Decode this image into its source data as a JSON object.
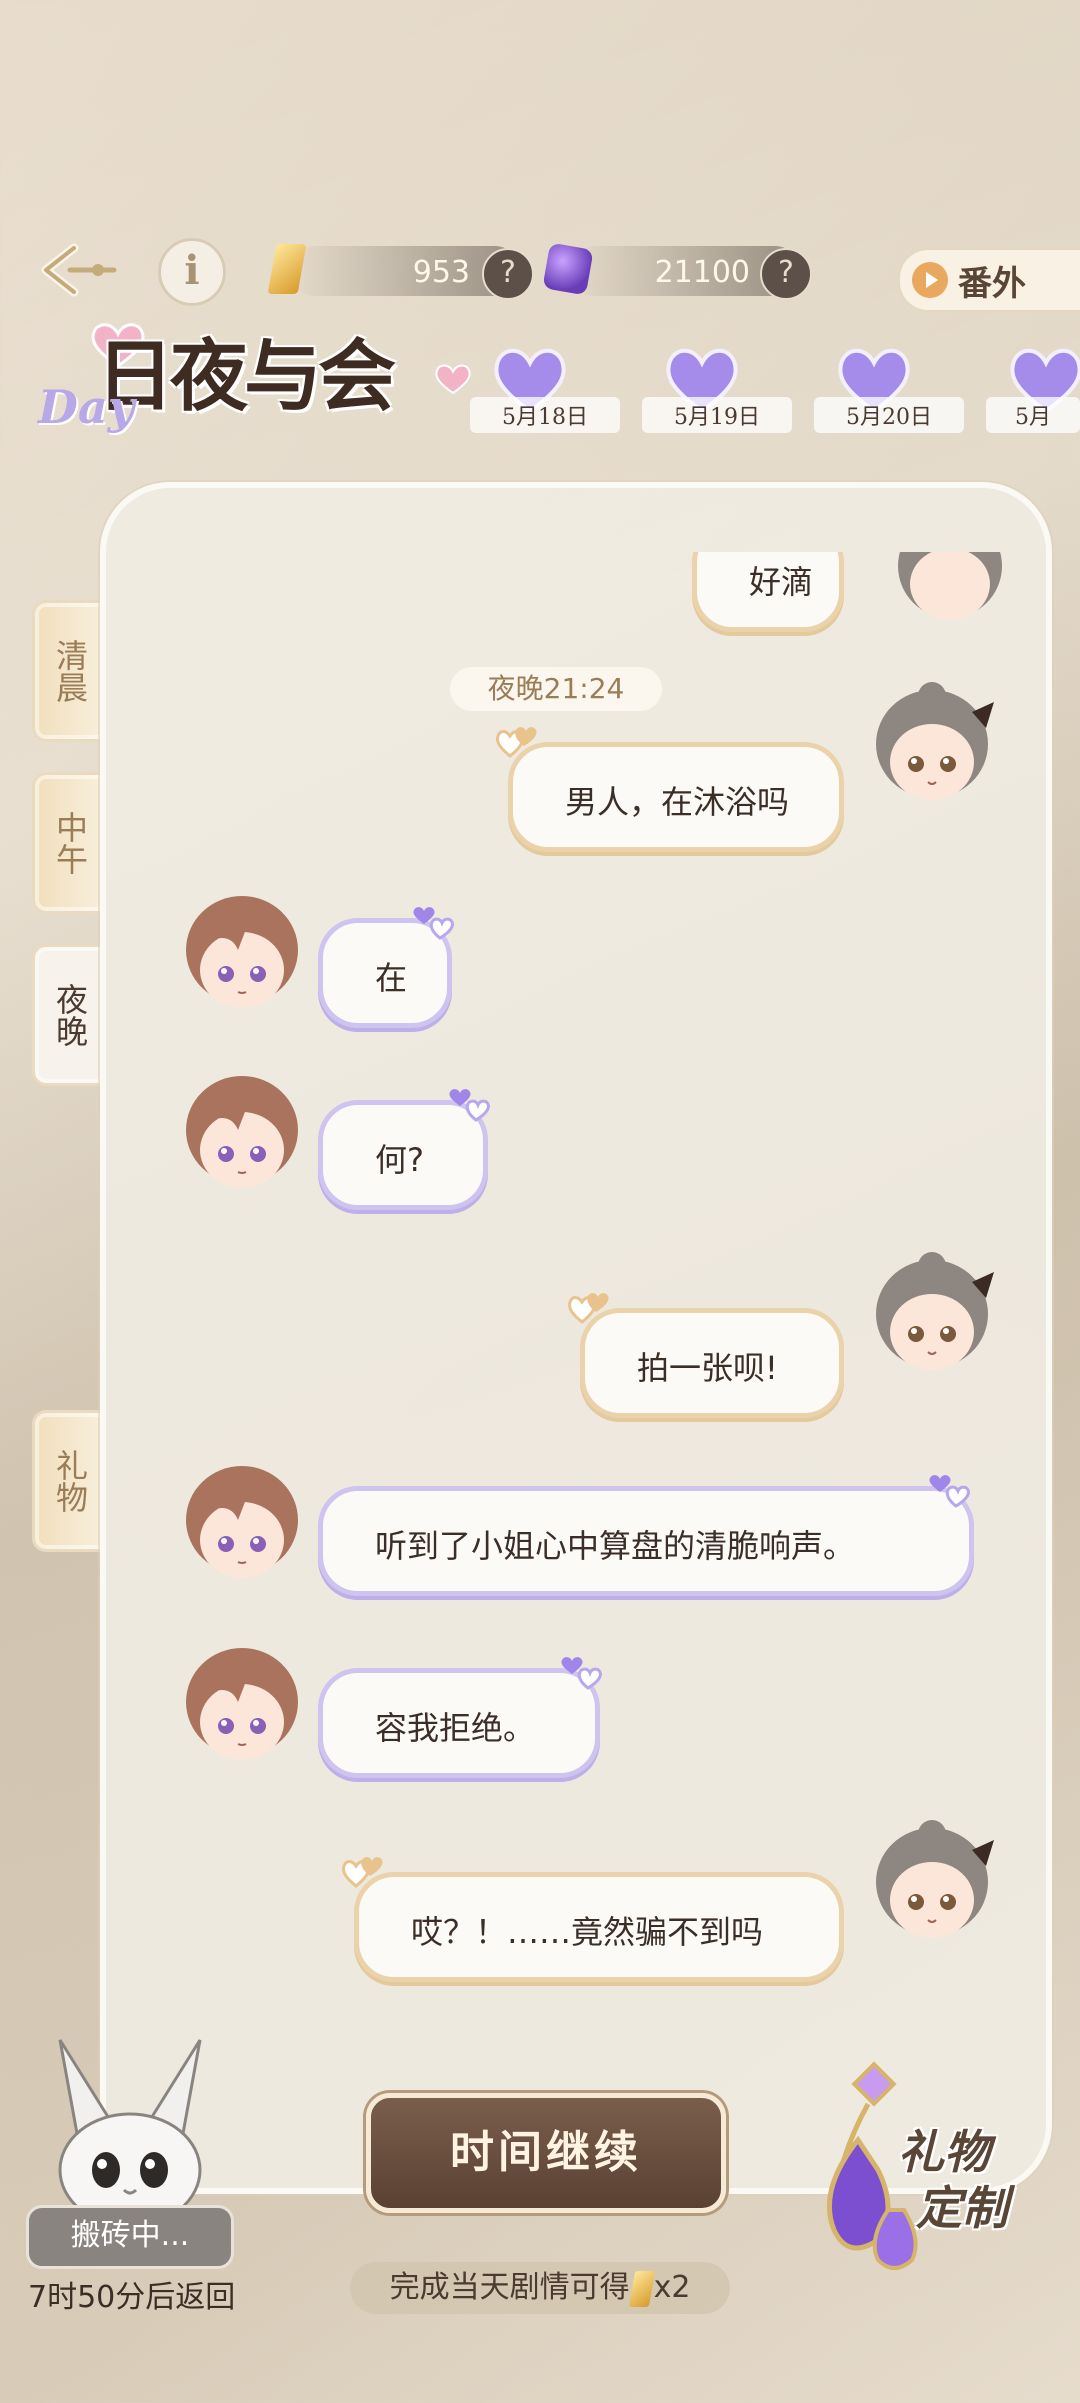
{
  "header": {
    "gold_value": "953",
    "gem_value": "21100",
    "help_glyph": "?",
    "extra_label": "番外",
    "info_glyph": "i"
  },
  "title": {
    "main": "日夜与会",
    "sub": "Day"
  },
  "dates": [
    "5月18日",
    "5月19日",
    "5月20日",
    "5月"
  ],
  "side_tabs": [
    {
      "label": "清晨",
      "active": false
    },
    {
      "label": "中午",
      "active": false
    },
    {
      "label": "夜晚",
      "active": true
    },
    {
      "label": "礼物",
      "active": false
    }
  ],
  "chat": {
    "time_chip": "夜晚21:24",
    "messages": [
      {
        "side": "right",
        "text": "好滴"
      },
      {
        "side": "right",
        "text": "男人，在沐浴吗"
      },
      {
        "side": "left",
        "text": "在"
      },
      {
        "side": "left",
        "text": "何?"
      },
      {
        "side": "right",
        "text": "拍一张呗!"
      },
      {
        "side": "left",
        "text": "听到了小姐心中算盘的清脆响声。"
      },
      {
        "side": "left",
        "text": "容我拒绝。"
      },
      {
        "side": "right",
        "text": "哎？！……竟然骗不到吗"
      }
    ]
  },
  "bottom": {
    "continue_label": "时间继续",
    "reward_prefix": "完成当天剧情可得",
    "reward_suffix": "x2",
    "pet_status": "搬砖中...",
    "pet_return": "7时50分后返回",
    "gift_line1": "礼物",
    "gift_line2": "定制"
  },
  "colors": {
    "accent_brown": "#5a4132",
    "bubble_border_gold": "#ead2ab",
    "bubble_border_purple": "#cfc3ef",
    "heart_purple": "#9f86e8"
  },
  "icons": [
    "back-arrow-icon",
    "info-icon",
    "gold-crystal-icon",
    "purple-gem-icon",
    "help-icon",
    "play-icon",
    "heart-icon",
    "bunny-pet-icon",
    "earring-gift-icon"
  ]
}
